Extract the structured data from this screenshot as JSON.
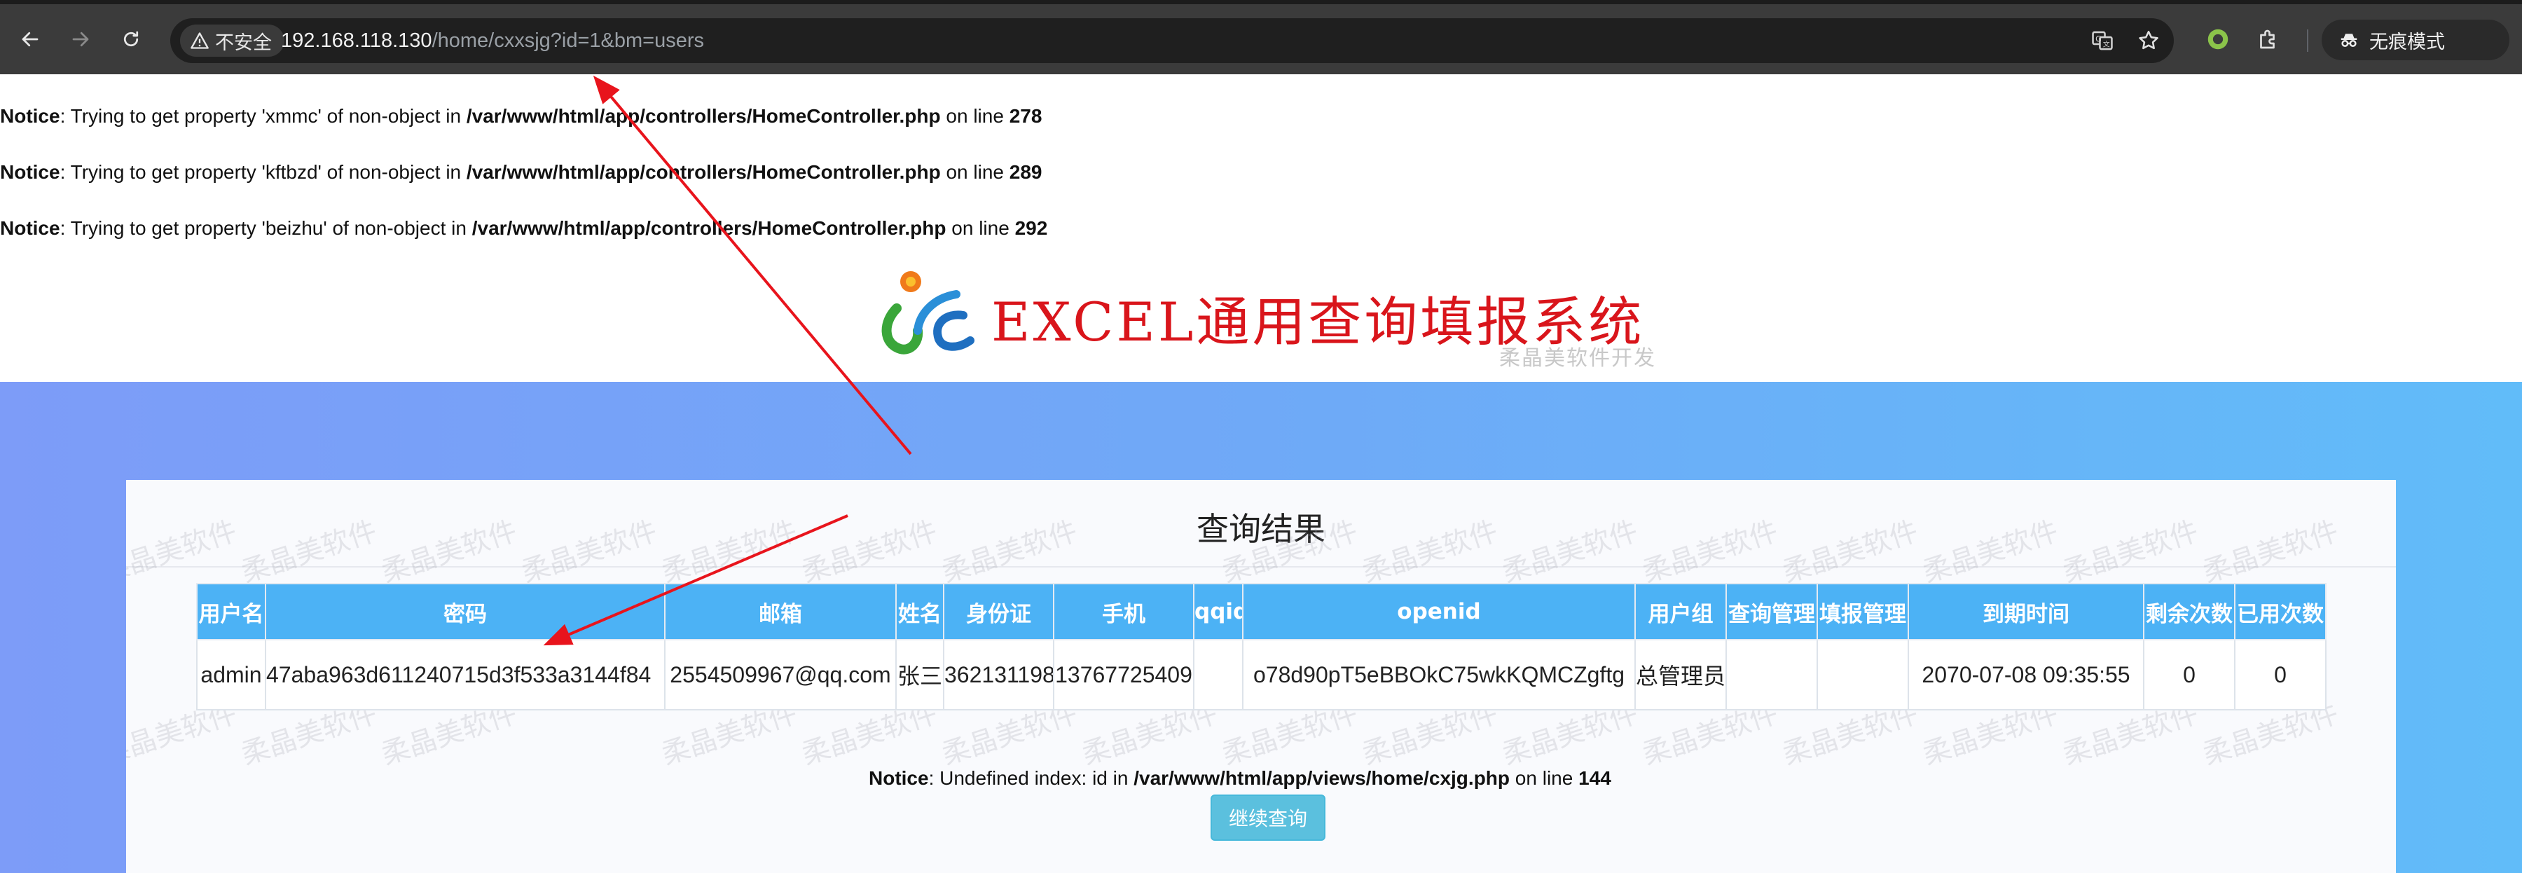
{
  "browser": {
    "security_label": "不安全",
    "url_host": "192.168.118.130",
    "url_path": "/home/cxxsjg?id=1&bm=users",
    "incognito_label": "无痕模式"
  },
  "notices": [
    {
      "label": "Notice",
      "message": ": Trying to get property 'xmmc' of non-object in ",
      "path": "/var/www/html/app/controllers/HomeController.php",
      "line_text": " on line ",
      "line": "278"
    },
    {
      "label": "Notice",
      "message": ": Trying to get property 'kftbzd' of non-object in ",
      "path": "/var/www/html/app/controllers/HomeController.php",
      "line_text": " on line ",
      "line": "289"
    },
    {
      "label": "Notice",
      "message": ": Trying to get property 'beizhu' of non-object in ",
      "path": "/var/www/html/app/controllers/HomeController.php",
      "line_text": " on line ",
      "line": "292"
    }
  ],
  "header": {
    "title": "EXCEL通用查询填报系统",
    "subtitle": "柔晶美软件开发"
  },
  "watermark": "柔晶美软件",
  "panel": {
    "title": "查询结果"
  },
  "table": {
    "columns": [
      "用户名",
      "密码",
      "邮箱",
      "姓名",
      "身份证",
      "手机",
      "qqid",
      "openid",
      "用户组",
      "查询管理",
      "填报管理",
      "到期时间",
      "剩余次数",
      "已用次数"
    ],
    "rows": [
      [
        "admin",
        "47aba963d611240715d3f533a3144f84",
        "2554509967@qq.com",
        "张三",
        "362131198",
        "13767725409",
        "",
        "o78d90pT5eBBOkC75wkKQMCZgftg",
        "总管理员",
        "",
        "",
        "2070-07-08 09:35:55",
        "0",
        "0"
      ]
    ]
  },
  "bottom_notice": {
    "label": "Notice",
    "message": ": Undefined index: id in ",
    "path": "/var/www/html/app/views/home/cxjg.php",
    "line_text": " on line ",
    "line": "144"
  },
  "continue_button": "继续查询",
  "colors": {
    "annotation": "#e8141c",
    "table_header": "#4cb2f5",
    "band_start": "#7d9cf8",
    "band_end": "#61bcf9",
    "button": "#5bc0de"
  }
}
